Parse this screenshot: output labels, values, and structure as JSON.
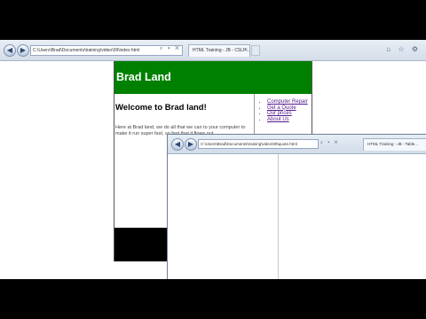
{
  "browser_back": {
    "back_glyph": "◀",
    "forward_glyph": "▶",
    "address": "C:\\Users\\Brad\\Documents\\training\\video\\09\\index.html",
    "address_icons": "⌕ ▾ ✕",
    "tab_title": "HTML Training - JB - CSLP...",
    "tab_close": "×",
    "tool_icons": "⌂ ☆ ⚙"
  },
  "page": {
    "banner_title": "Brad Land",
    "banner_color": "#008000",
    "heading": "Welcome to Brad land!",
    "intro": "Here at Brad land, we do all that we can to your computer to make it run super fast, so fast that it flows out.",
    "sidebar_links": [
      "Computer Repair",
      "Get a Quote",
      "Our prices",
      "About Us"
    ]
  },
  "browser_front": {
    "back_glyph": "◀",
    "forward_glyph": "▶",
    "address": "C:\\Users\\Brad\\Documents\\training\\video\\09\\quote.html",
    "address_icons": "⌕ ▾ ✕",
    "tab_title": "HTML Training - JB - Table..."
  }
}
